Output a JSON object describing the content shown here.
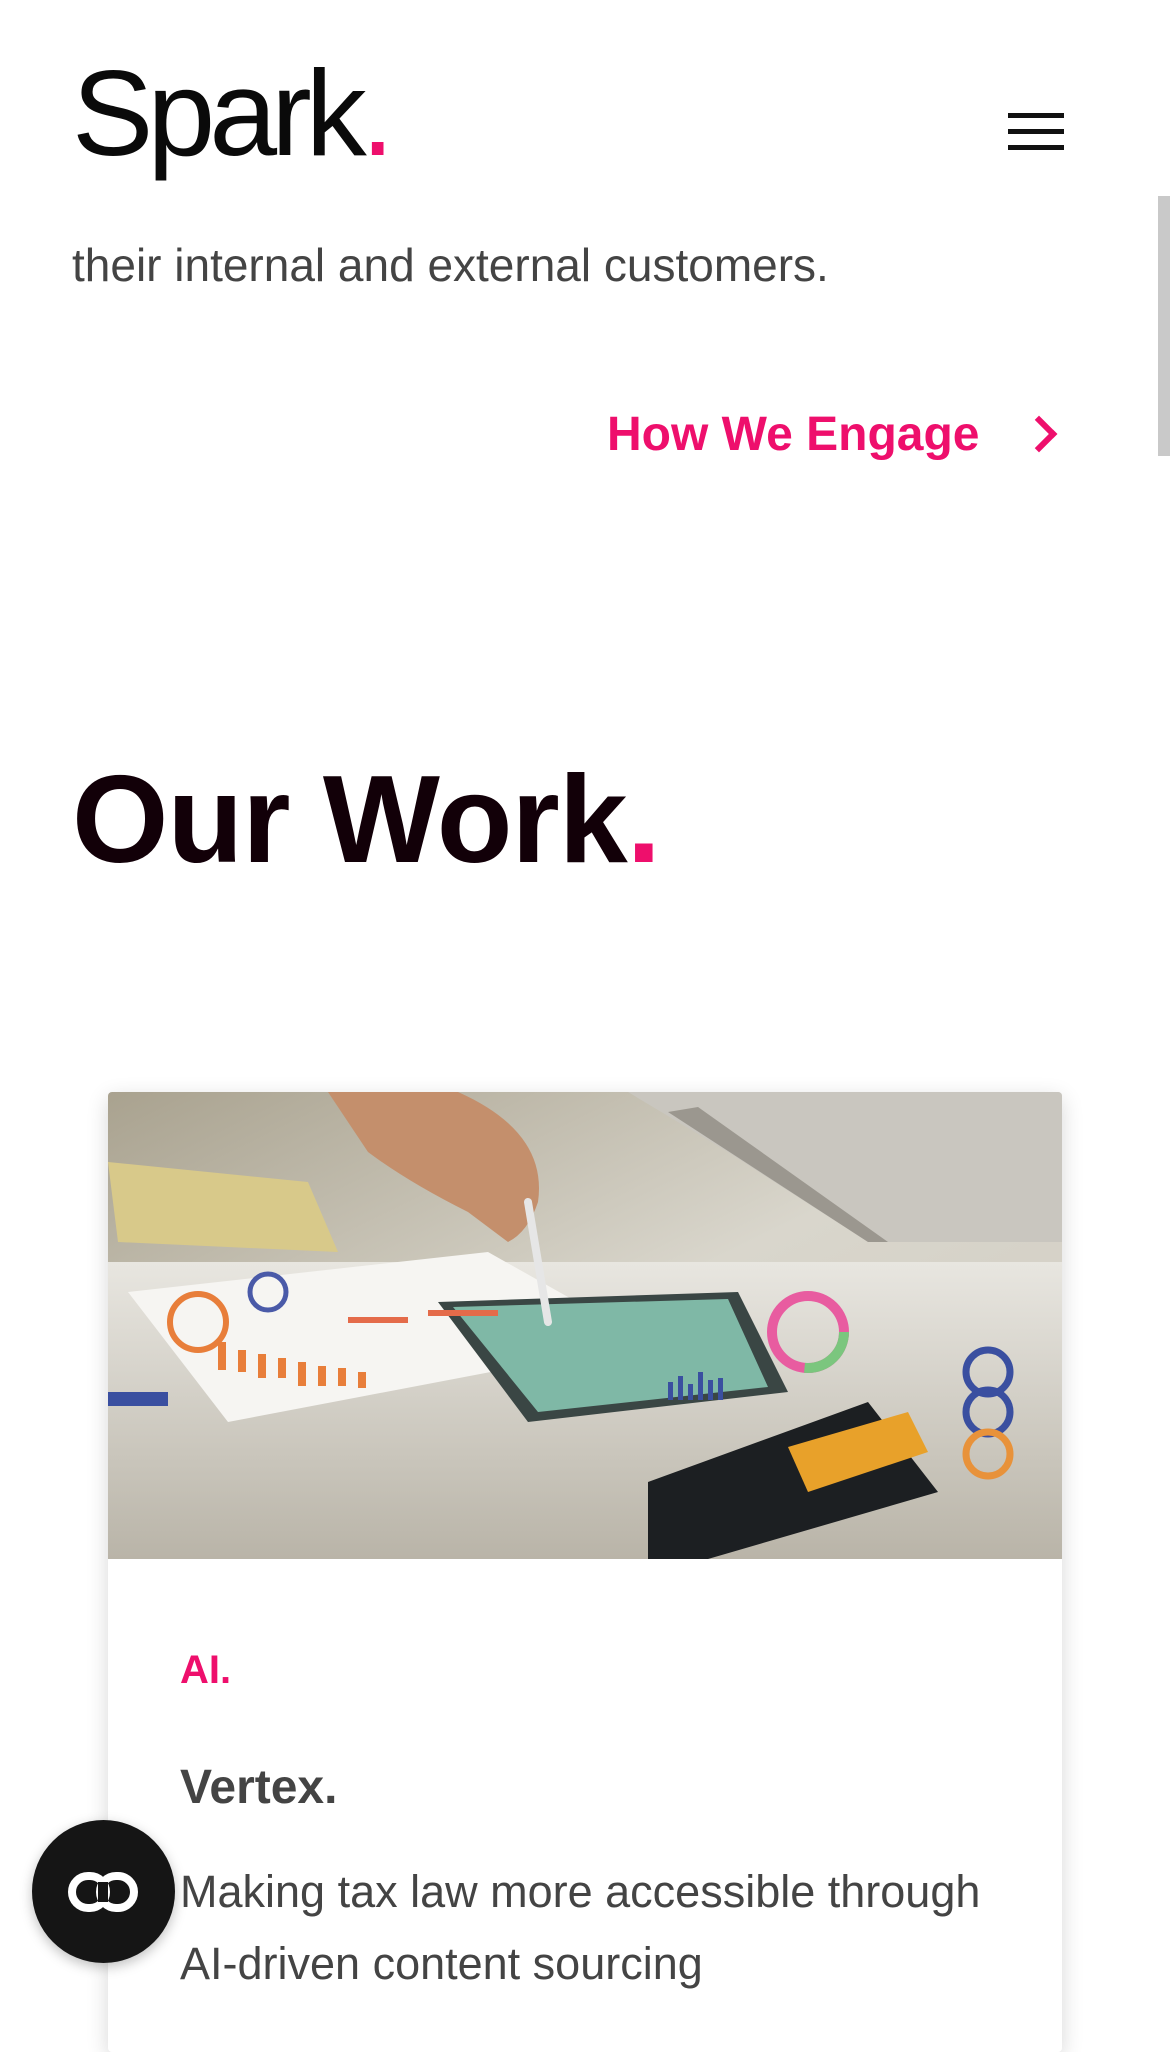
{
  "header": {
    "logo_text": "Spark",
    "logo_dot": ".",
    "menu_icon": "hamburger-icon"
  },
  "intro": {
    "text_partial": "their internal and external customers."
  },
  "engage_link": {
    "label": "How We Engage",
    "icon": "chevron-right-icon"
  },
  "work": {
    "title": "Our Work",
    "title_dot": "."
  },
  "card": {
    "tag": "AI.",
    "title": "Vertex.",
    "description": "Making tax law more accessible through AI-driven content sourcing"
  },
  "chat_button": {
    "icon": "chat-link-icon"
  },
  "colors": {
    "accent": "#ee0f6c",
    "text_dark": "#120008",
    "text_body": "#444444"
  }
}
